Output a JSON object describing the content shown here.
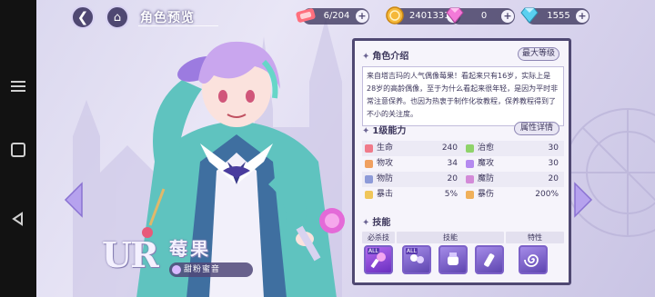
{
  "top_bar": {
    "title": "角色预览",
    "back_icon": "back-arrow-icon",
    "home_icon": "castle-home-icon"
  },
  "resources": [
    {
      "name": "stamina",
      "icon": "ticket-icon",
      "value": "6/204"
    },
    {
      "name": "gold",
      "icon": "coin-icon",
      "value": "2401331"
    },
    {
      "name": "gem-pink",
      "icon": "pink-diamond-icon",
      "value": "0"
    },
    {
      "name": "gem-blue",
      "icon": "blue-diamond-icon",
      "value": "1555"
    }
  ],
  "character": {
    "rarity": "UR",
    "name": "莓果",
    "subtitle": "甜粉蜜音"
  },
  "panel": {
    "intro_title": "角色介绍",
    "max_level_button": "最大等级",
    "intro_text": "来自塔吉玛的人气偶像莓果！看起来只有16岁，实际上是28岁的高龄偶像，至于为什么看起来很年轻，是因为平时非常注意保养。也因为热衷于制作化妆教程，保养教程得到了不小的关注度。",
    "stats_title": "1级能力",
    "stats_detail_button": "属性详情",
    "stats": [
      [
        {
          "label": "生命",
          "value": "240",
          "color": "#f07a8a"
        },
        {
          "label": "治愈",
          "value": "30",
          "color": "#8fd36a"
        }
      ],
      [
        {
          "label": "物攻",
          "value": "34",
          "color": "#f0a060"
        },
        {
          "label": "魔攻",
          "value": "30",
          "color": "#b58af0"
        }
      ],
      [
        {
          "label": "物防",
          "value": "20",
          "color": "#8d9ad8"
        },
        {
          "label": "魔防",
          "value": "20",
          "color": "#d38ad8"
        }
      ],
      [
        {
          "label": "暴击",
          "value": "5%",
          "color": "#f0c65a"
        },
        {
          "label": "暴伤",
          "value": "200%",
          "color": "#f0b05a"
        }
      ]
    ],
    "skills_title": "技能",
    "skill_labels": {
      "ultimate": "必杀技",
      "skill": "技能",
      "trait": "特性"
    },
    "skill_tag": "ALL"
  },
  "colors": {
    "panel_border": "#4f4872",
    "accent": "#7c61c8"
  }
}
